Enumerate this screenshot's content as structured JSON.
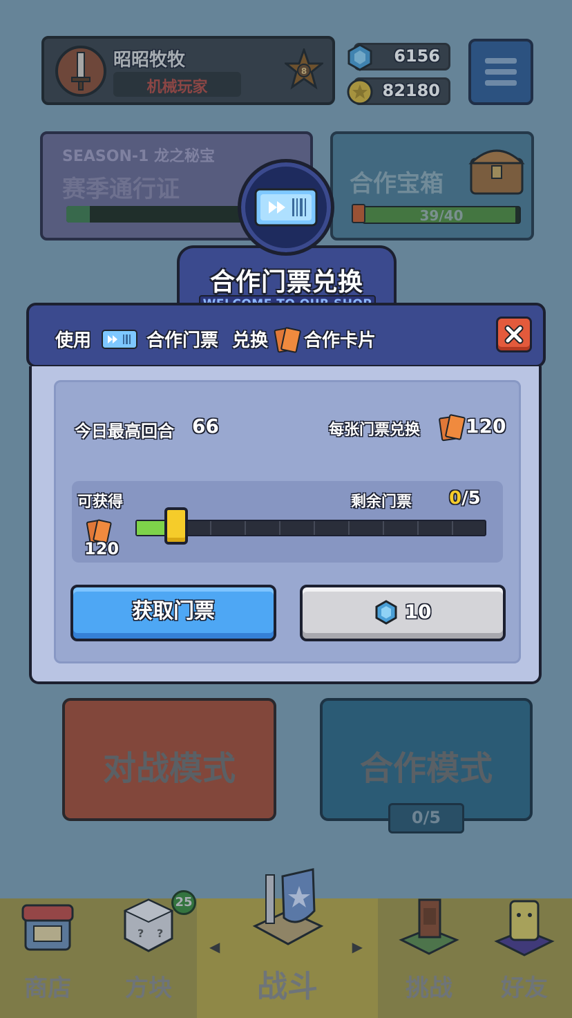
{
  "top": {
    "player_name": "昭昭牧牧",
    "player_title": "机械玩家",
    "rank_level": "8",
    "gems": "6156",
    "coins": "82180"
  },
  "season": {
    "title": "SEASON-1  龙之秘宝",
    "subtitle": "赛季通行证"
  },
  "coop_chest": {
    "title": "合作宝箱",
    "progress_text": "39/40",
    "progress": 0.975
  },
  "modes": {
    "battle_label": "对战模式",
    "coop_label": "合作模式",
    "coop_count": "0/5"
  },
  "nav": {
    "items": [
      {
        "label": "商店"
      },
      {
        "label": "方块"
      },
      {
        "label": "战斗"
      },
      {
        "label": "挑战"
      },
      {
        "label": "好友"
      }
    ],
    "blocks_badge": "25"
  },
  "modal": {
    "title": "合作门票兑换",
    "subtitle": "WELCOME TO OUR SHOP",
    "use_text": "使用",
    "ticket_text": "合作门票",
    "exchange_text": "兑换",
    "card_text": "合作卡片",
    "max_round_label": "今日最高回合",
    "max_round_value": "66",
    "per_ticket_label": "每张门票兑换",
    "per_ticket_value": "120",
    "obtainable_label": "可获得",
    "obtainable_value": "120",
    "remaining_label": "剩余门票",
    "remaining_current": "0",
    "remaining_total": "/5",
    "slider_fraction": 0.1,
    "get_ticket_button": "获取门票",
    "buy_price": "10"
  },
  "colors": {
    "accent_blue": "#4ea7f4",
    "panel": "#b9c4e3",
    "header": "#3b4a8e",
    "close": "#e35a3c",
    "handle": "#f5cc2a"
  }
}
